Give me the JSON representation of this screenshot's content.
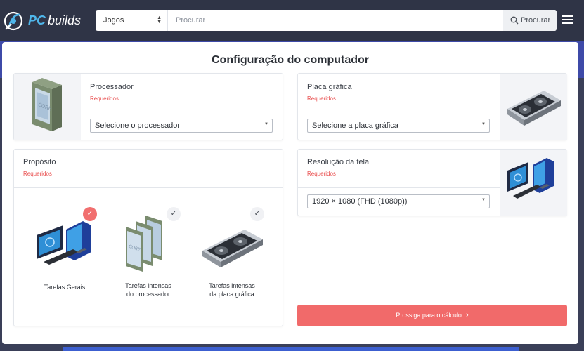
{
  "header": {
    "logo_part1": "PC",
    "logo_part2": "builds",
    "search": {
      "category": "Jogos",
      "placeholder": "Procurar",
      "button_label": "Procurar"
    }
  },
  "page": {
    "title": "Configuração do computador"
  },
  "processor": {
    "title": "Processador",
    "required": "Requeridos",
    "select_value": "Selecione o processador"
  },
  "gpu": {
    "title": "Placa gráfica",
    "required": "Requeridos",
    "select_value": "Selecione a placa gráfica"
  },
  "purpose": {
    "title": "Propósito",
    "required": "Requeridos",
    "options": [
      {
        "label_line1": "Tarefas Gerais",
        "label_line2": "",
        "selected": true
      },
      {
        "label_line1": "Tarefas intensas",
        "label_line2": "do processador",
        "selected": false
      },
      {
        "label_line1": "Tarefas intensas",
        "label_line2": "da placa gráfica",
        "selected": false
      }
    ]
  },
  "resolution": {
    "title": "Resolução da tela",
    "required": "Requeridos",
    "select_value": "1920 × 1080 (FHD (1080p))"
  },
  "proceed": {
    "label": "Prossiga para o cálculo"
  },
  "colors": {
    "navbar": "#2f3446",
    "accent_blue": "#4fb6ea",
    "required_red": "#e94e4e",
    "button_red": "#f16a6a"
  },
  "icons": [
    "logo-icon",
    "search-icon",
    "menu-icon",
    "check-icon",
    "chevron-right-icon",
    "cpu-icon",
    "gpu-icon",
    "computer-icon"
  ]
}
